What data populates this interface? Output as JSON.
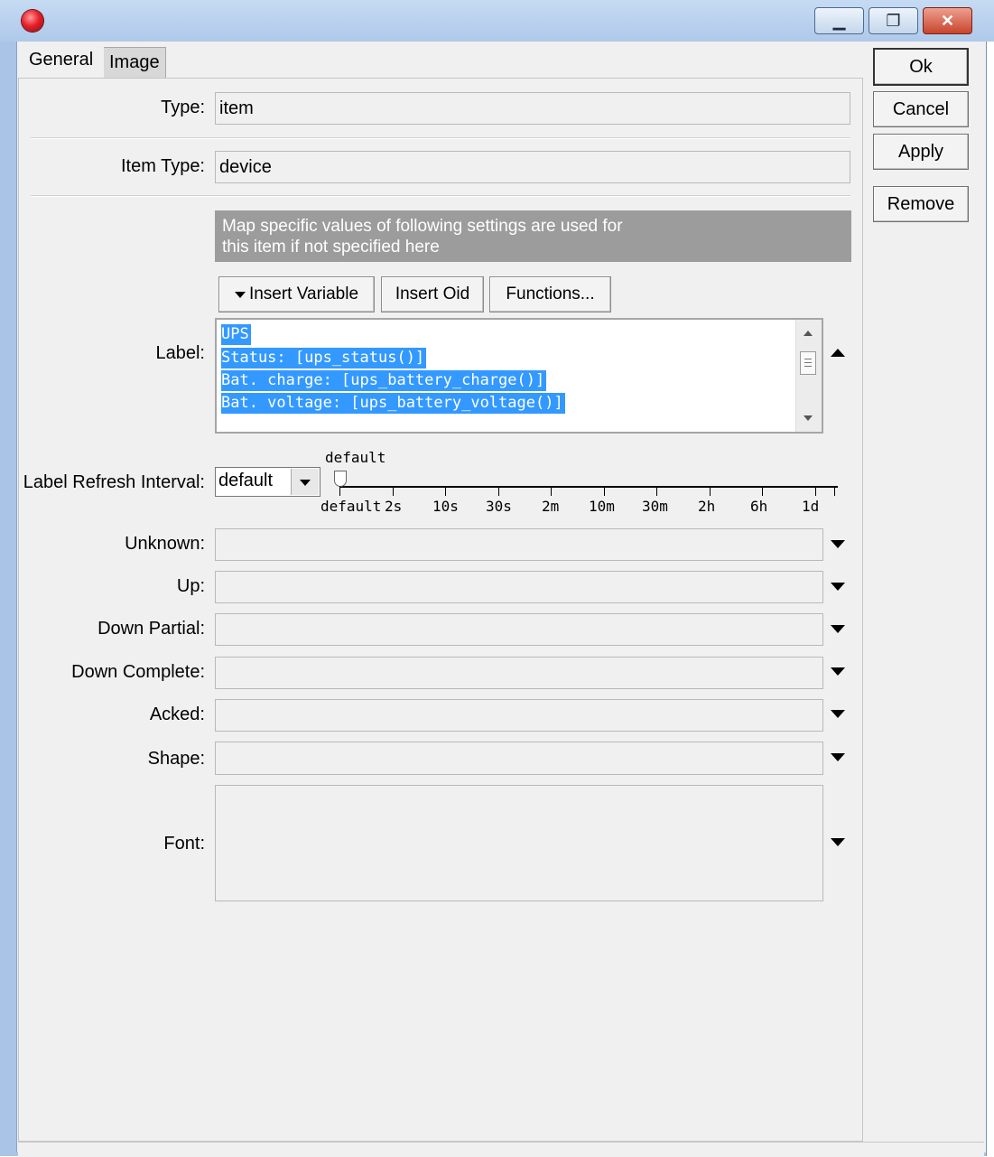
{
  "window": {
    "minimize_glyph": "▁",
    "maximize_glyph": "❐",
    "close_glyph": "✕"
  },
  "tabs": [
    {
      "label": "General",
      "active": true
    },
    {
      "label": "Image",
      "active": false
    }
  ],
  "form": {
    "type": {
      "label": "Type:",
      "value": "item"
    },
    "item_type": {
      "label": "Item Type:",
      "value": "device"
    },
    "banner": {
      "line1": "Map specific values of following settings are used for",
      "line2": "this item if not specified here"
    },
    "toolbar": {
      "insert_variable": "Insert Variable",
      "insert_oid": "Insert Oid",
      "functions": "Functions..."
    },
    "label": {
      "label": "Label:",
      "lines": [
        "UPS",
        "Status: [ups_status()]",
        "Bat. charge: [ups_battery_charge()]",
        "Bat. voltage: [ups_battery_voltage()]"
      ]
    },
    "refresh": {
      "label": "Label Refresh Interval:",
      "value": "default",
      "slider_current": "default",
      "ticks": [
        "default",
        "2s",
        "10s",
        "30s",
        "2m",
        "10m",
        "30m",
        "2h",
        "6h",
        "1d"
      ]
    },
    "unknown": {
      "label": "Unknown:",
      "value": ""
    },
    "up": {
      "label": "Up:",
      "value": ""
    },
    "down_partial": {
      "label": "Down Partial:",
      "value": ""
    },
    "down_complete": {
      "label": "Down Complete:",
      "value": ""
    },
    "acked": {
      "label": "Acked:",
      "value": ""
    },
    "shape": {
      "label": "Shape:",
      "value": ""
    },
    "font": {
      "label": "Font:",
      "value": ""
    }
  },
  "actions": {
    "ok": "Ok",
    "cancel": "Cancel",
    "apply": "Apply",
    "remove": "Remove"
  },
  "colors": {
    "selection": "#3399ff",
    "banner": "#9c9c9c",
    "titlebar": "#afc9ea"
  }
}
